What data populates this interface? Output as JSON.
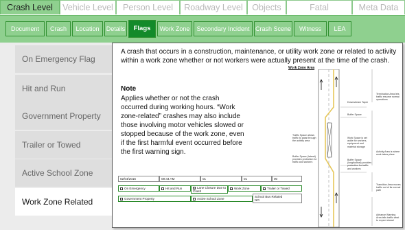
{
  "top_tabs": [
    "Crash Level",
    "Vehicle Level",
    "Person Level",
    "Roadway Level",
    "Objects",
    "Fatal Supplement",
    "Meta Data"
  ],
  "sub_tabs": [
    "Document",
    "Crash",
    "Location",
    "Details",
    "Flags",
    "Work Zone",
    "Secondary Incident",
    "Crash Scene",
    "Witness",
    "LEA"
  ],
  "flags": [
    "On Emergency Flag",
    "Hit and Run",
    "Government Property",
    "Trailer or Towed",
    "Active School Zone",
    "Work Zone Related"
  ],
  "info": {
    "description": "A crash that occurs in a construction, maintenance, or utility work zone or related to activity within a work zone whether or not workers were actually present at the time of the crash.",
    "note_title": "Note",
    "note_body": "Applies whether or not the crash occurred during working hours.  “Work zone-related” crashes may also include those involving motor vehicles slowed or stopped because of the work zone, even if the first harmful event occurred before the first warning sign."
  },
  "diagram": {
    "title": "Work Zone Area",
    "labels": {
      "termination": "Termination Area lets traffic resume normal operations",
      "downstream": "Downstream Taper",
      "buffer": "Buffer Space",
      "traffic_space": "Traffic Space allows traffic to pass through the activity area",
      "work_space": "Work Space is set aside for workers, equipment and material storage",
      "activity": "Activity Area is where work takes place",
      "buffer_lateral": "Buffer Space (lateral) provides protection for traffic and workers",
      "buffer_long": "Buffer Space (longitudinal) provides protection for traffic and workers",
      "transition": "Transition Area moves traffic out of its normal path",
      "advance": "Advance Warning Area tells traffic what to expect ahead"
    }
  },
  "form_mock": {
    "date": "02/04/2016",
    "time": "09:44 AM",
    "code1": "01",
    "code2": "01",
    "code3": "00",
    "checkboxes": [
      "On Emergency",
      "Hit and Run",
      "Lane Closure Due to Crash",
      "Work Zone",
      "Trailer or Towed",
      "Government Property",
      "Active School Zone"
    ],
    "school_bus_label": "School Bus Related",
    "school_bus_value": "NO"
  }
}
